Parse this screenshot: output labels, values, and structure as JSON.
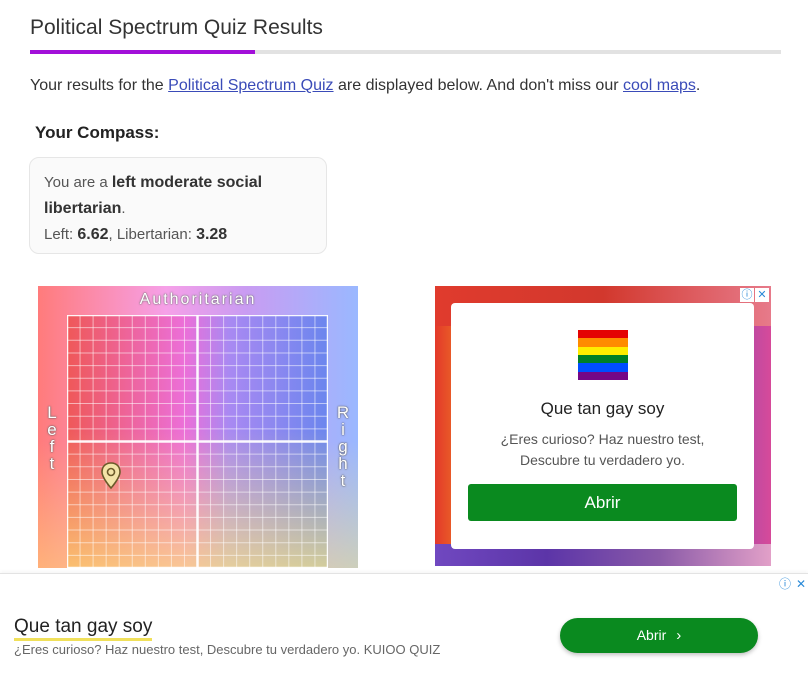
{
  "page": {
    "title": "Political Spectrum Quiz Results",
    "intro": {
      "prefix": "Your results for the ",
      "quiz_link": "Political Spectrum Quiz",
      "middle": " are displayed below. And don't miss our ",
      "maps_link": "cool maps",
      "suffix": "."
    }
  },
  "compass": {
    "heading": "Your Compass:",
    "result_prefix": "You are a ",
    "result_value": "left moderate social libertarian",
    "result_suffix": ".",
    "left_label": "Left:",
    "left_value": "6.62",
    "lib_label": "Libertarian:",
    "lib_value": "3.28",
    "axis_top": "Authoritarian",
    "axis_left": "Left",
    "axis_right": "Right",
    "marker_icon": "map-pin-icon"
  },
  "ad_right": {
    "title": "Que tan gay soy",
    "desc": "¿Eres curioso? Haz nuestro test, Descubre tu verdadero yo.",
    "button": "Abrir",
    "info_icon": "ⓘ",
    "close_icon": "✕",
    "flag_colors": [
      "#e40303",
      "#ff8c00",
      "#ffed00",
      "#008026",
      "#004dff",
      "#750787"
    ]
  },
  "banner_ad": {
    "title": "Que tan gay soy",
    "desc": "¿Eres curioso? Haz nuestro test, Descubre tu verdadero yo. KUIOO QUIZ",
    "button": "Abrir",
    "chevron": "›",
    "info_icon": "ⓘ",
    "close_icon": "✕"
  },
  "colors": {
    "accent": "#a20fd9",
    "link": "#3a4bb8",
    "ad_button": "#0a8a1f"
  }
}
